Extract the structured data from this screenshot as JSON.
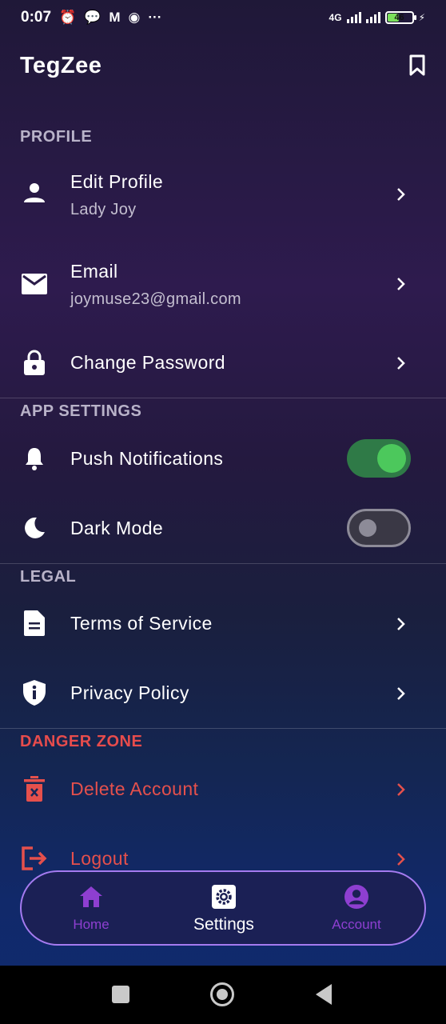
{
  "status_bar": {
    "time": "0:07",
    "network": "4G",
    "battery": "46"
  },
  "header": {
    "logo": "TegZee"
  },
  "sections": {
    "profile": "PROFILE",
    "app_settings": "APP SETTINGS",
    "legal": "LEGAL",
    "danger_zone": "DANGER ZONE"
  },
  "profile": {
    "edit_profile": {
      "title": "Edit Profile",
      "value": "Lady Joy"
    },
    "email": {
      "title": "Email",
      "value": "joymuse23@gmail.com"
    },
    "change_password": {
      "title": "Change Password"
    }
  },
  "app_settings": {
    "push_notifications": {
      "title": "Push Notifications",
      "enabled": true
    },
    "dark_mode": {
      "title": "Dark Mode",
      "enabled": false
    }
  },
  "legal": {
    "terms": "Terms of Service",
    "privacy": "Privacy Policy"
  },
  "danger": {
    "delete_account": "Delete Account",
    "logout": "Logout"
  },
  "bottom_nav": {
    "items": [
      {
        "label": "Home",
        "icon": "home-icon"
      },
      {
        "label": "Settings",
        "icon": "gear-icon",
        "active": true
      },
      {
        "label": "Account",
        "icon": "account-circle-icon"
      }
    ]
  },
  "colors": {
    "accent": "#8e3fd1",
    "danger": "#e74c4c",
    "toggle_on": "#4cc85c",
    "nav_border": "#a57bf0"
  }
}
